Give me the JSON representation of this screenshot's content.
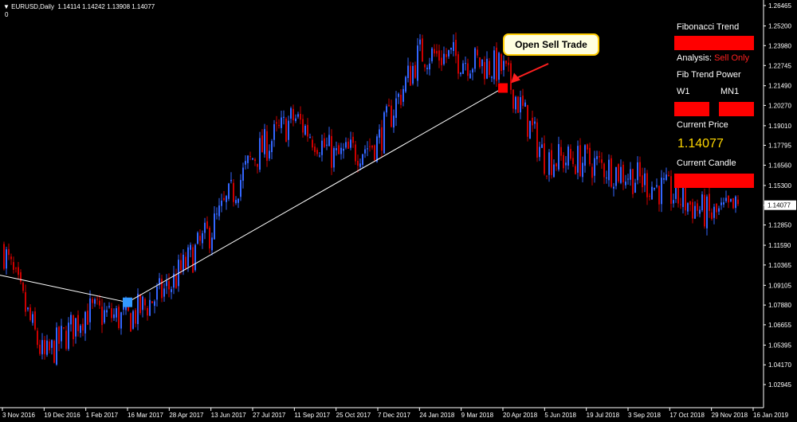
{
  "header": {
    "menu_glyph": "▼",
    "symbol": "EURUSD,Daily",
    "ohlc": "1.14114 1.14242 1.13908 1.14077",
    "subline": "0"
  },
  "x_axis_labels": [
    "3 Nov 2016",
    "19 Dec 2016",
    "1 Feb 2017",
    "16 Mar 2017",
    "28 Apr 2017",
    "13 Jun 2017",
    "27 Jul 2017",
    "11 Sep 2017",
    "25 Oct 2017",
    "7 Dec 2017",
    "24 Jan 2018",
    "9 Mar 2018",
    "20 Apr 2018",
    "5 Jun 2018",
    "19 Jul 2018",
    "3 Sep 2018",
    "17 Oct 2018",
    "29 Nov 2018",
    "16 Jan 2019"
  ],
  "y_axis_labels": [
    "1.26465",
    "1.25200",
    "1.23980",
    "1.22745",
    "1.21490",
    "1.20270",
    "1.19010",
    "1.17795",
    "1.16560",
    "1.15300",
    "1.14077",
    "1.12850",
    "1.11590",
    "1.10365",
    "1.09105",
    "1.07880",
    "1.06655",
    "1.05395",
    "1.04170",
    "1.02945"
  ],
  "current_price_tag": "1.14077",
  "callout": {
    "text": "Open Sell Trade"
  },
  "panel": {
    "title": "Fibonacci Trend",
    "analysis_label": "Analysis:",
    "analysis_value": "Sell Only",
    "power_title": "Fib Trend Power",
    "w1_label": "W1",
    "mn1_label": "MN1",
    "price_title": "Current Price",
    "price_value": "1.14077",
    "candle_title": "Current Candle"
  },
  "colors": {
    "bull": "#3366ff",
    "bear": "#cc0000",
    "trend": "#ffffff",
    "background": "#000000"
  },
  "chart_data": {
    "type": "candlestick",
    "symbol": "EURUSD",
    "timeframe": "Daily",
    "ylim": [
      1.02945,
      1.26465
    ],
    "path": [
      [
        "3 Nov 2016",
        1.115
      ],
      [
        "19 Dec 2016",
        1.045
      ],
      [
        "1 Feb 2017",
        1.075
      ],
      [
        "16 Mar 2017",
        1.07
      ],
      [
        "28 Apr 2017",
        1.09
      ],
      [
        "13 Jun 2017",
        1.125
      ],
      [
        "27 Jul 2017",
        1.17
      ],
      [
        "11 Sep 2017",
        1.195
      ],
      [
        "25 Oct 2017",
        1.17
      ],
      [
        "7 Dec 2017",
        1.18
      ],
      [
        "24 Jan 2018",
        1.235
      ],
      [
        "9 Mar 2018",
        1.232
      ],
      [
        "20 Apr 2018",
        1.225
      ],
      [
        "5 Jun 2018",
        1.17
      ],
      [
        "19 Jul 2018",
        1.168
      ],
      [
        "3 Sep 2018",
        1.16
      ],
      [
        "17 Oct 2018",
        1.148
      ],
      [
        "29 Nov 2018",
        1.134
      ],
      [
        "16 Jan 2019",
        1.141
      ]
    ],
    "trend_lines": [
      {
        "points": [
          [
            "3 Nov 2016",
            1.097
          ],
          [
            "16 Mar 2017",
            1.0805
          ]
        ]
      },
      {
        "points": [
          [
            "16 Mar 2017",
            1.0805
          ],
          [
            "20 Apr 2018",
            1.2135
          ]
        ]
      }
    ],
    "markers": [
      {
        "kind": "buy",
        "date": "16 Mar 2017",
        "price": 1.0805,
        "color": "#3399ff"
      },
      {
        "kind": "sell",
        "date": "20 Apr 2018",
        "price": 1.2135,
        "color": "#ff0000"
      }
    ]
  }
}
